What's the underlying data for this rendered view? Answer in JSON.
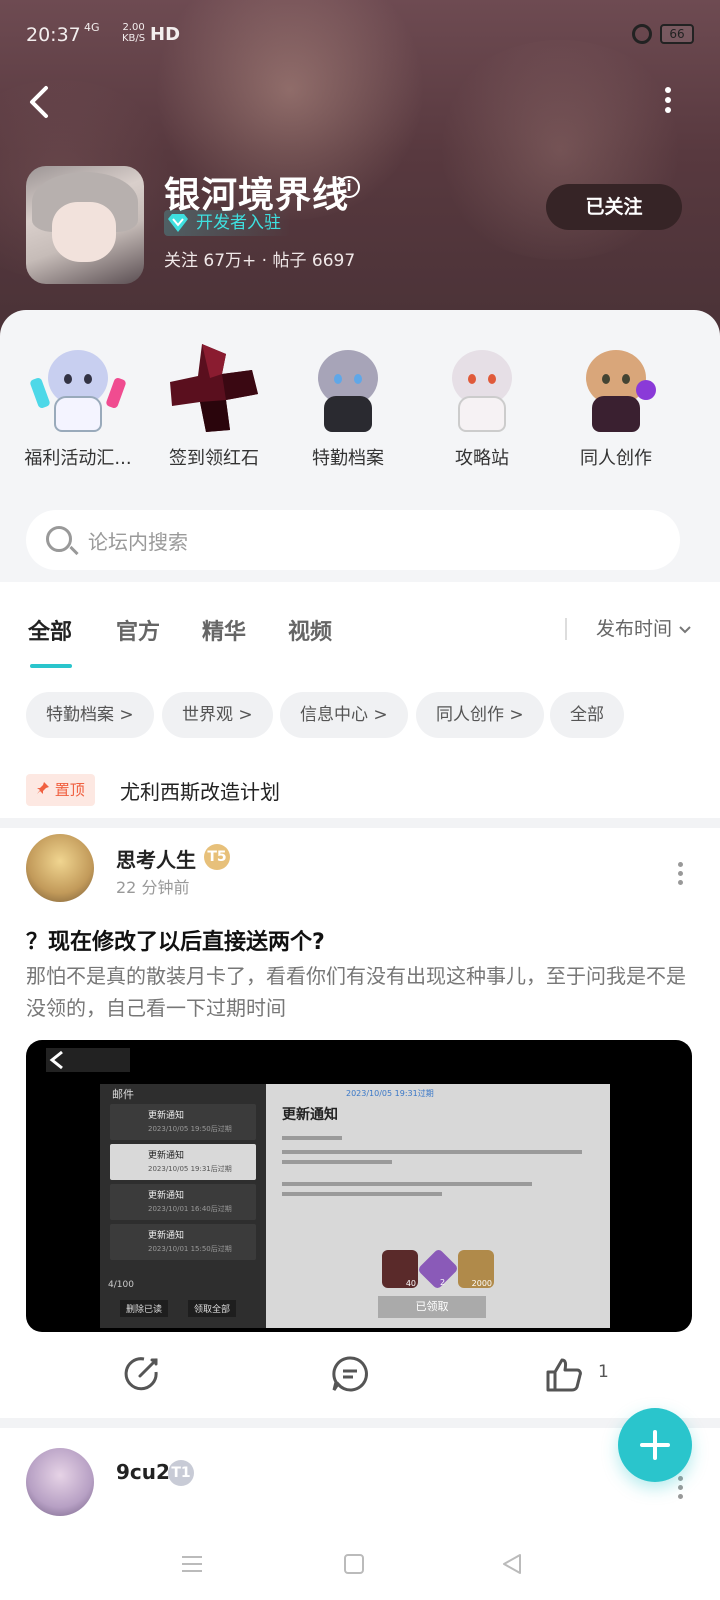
{
  "status_bar": {
    "time": "20:37",
    "network": "4G",
    "speed_value": "2.00",
    "speed_unit": "KB/S",
    "hd": "HD",
    "battery": "66"
  },
  "header": {
    "game_title": "银河境界线",
    "badge": "开发者入驻",
    "stats": "关注 67万+ · 帖子 6697",
    "follow_label": "已关注"
  },
  "quick_links": [
    {
      "label": "福利活动汇..."
    },
    {
      "label": "签到领红石"
    },
    {
      "label": "特勤档案"
    },
    {
      "label": "攻略站"
    },
    {
      "label": "同人创作"
    }
  ],
  "search": {
    "placeholder": "论坛内搜索"
  },
  "tabs": [
    {
      "label": "全部",
      "active": true
    },
    {
      "label": "官方"
    },
    {
      "label": "精华"
    },
    {
      "label": "视频"
    }
  ],
  "sort": {
    "label": "发布时间"
  },
  "chips": [
    {
      "label": "特勤档案 >"
    },
    {
      "label": "世界观 >"
    },
    {
      "label": "信息中心 >"
    },
    {
      "label": "同人创作 >"
    },
    {
      "label": "全部"
    }
  ],
  "pinned": {
    "badge": "置顶",
    "title": "尤利西斯改造计划"
  },
  "posts": [
    {
      "author": "思考人生",
      "level": "T5",
      "time": "22 分钟前",
      "title": "？现在修改了以后直接送两个?",
      "body": "那怕不是真的散装月卡了，看看你们有没有出现这种事儿，至于问我是不是没领的，自己看一下过期时间",
      "like_count": "1",
      "screenshot": {
        "mail_header": "邮件",
        "mail_items": [
          {
            "title": "更新通知",
            "date": "2023/10/05 19:50后过期"
          },
          {
            "title": "更新通知",
            "date": "2023/10/05 19:31后过期"
          },
          {
            "title": "更新通知",
            "date": "2023/10/01 16:40后过期"
          },
          {
            "title": "更新通知",
            "date": "2023/10/01 15:50后过期"
          }
        ],
        "count": "4/100",
        "delete_read": "删除已读",
        "claim_all": "领取全部",
        "detail_title": "更新通知",
        "detail_expiry": "2023/10/05 19:31过期",
        "claimed": "已领取",
        "item_counts": [
          "40",
          "2",
          "2000"
        ]
      }
    },
    {
      "author": "9cu2",
      "level": "T1"
    }
  ],
  "colors": {
    "accent": "#2ac5cc",
    "follow_bg": "#362426",
    "pin": "#f06040"
  }
}
